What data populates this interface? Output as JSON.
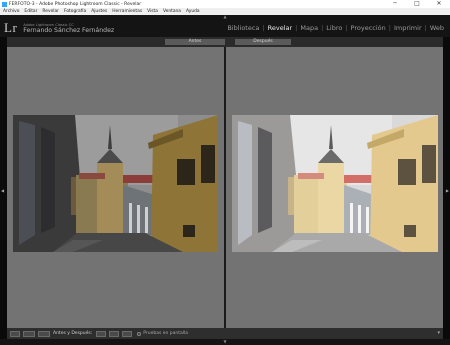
{
  "window": {
    "title": "FERFOTO-3 - Adobe Photoshop Lightroom Classic - Revelar",
    "minimize": "─",
    "maximize": "□",
    "close": "✕"
  },
  "menu": [
    "Archivo",
    "Editar",
    "Revelar",
    "Fotografía",
    "Ajustes",
    "Herramientas",
    "Vista",
    "Ventana",
    "Ayuda"
  ],
  "identity": {
    "logo": "Lr",
    "product": "Adobe Lightroom Classic CC",
    "user": "Fernando Sánchez Fernández"
  },
  "modules": [
    {
      "label": "Biblioteca",
      "active": false
    },
    {
      "label": "Revelar",
      "active": true
    },
    {
      "label": "Mapa",
      "active": false
    },
    {
      "label": "Libro",
      "active": false
    },
    {
      "label": "Proyección",
      "active": false
    },
    {
      "label": "Imprimir",
      "active": false
    },
    {
      "label": "Web",
      "active": false
    }
  ],
  "compare": {
    "before_label": "Antes",
    "after_label": "Después"
  },
  "toolbar": {
    "mode_label": "Antes y Después:",
    "softproof_label": "Pruebas en pantalla"
  },
  "colors": {
    "workspace": "#737373",
    "panel": "#141414",
    "accent_logo": "#cfcfcf"
  }
}
